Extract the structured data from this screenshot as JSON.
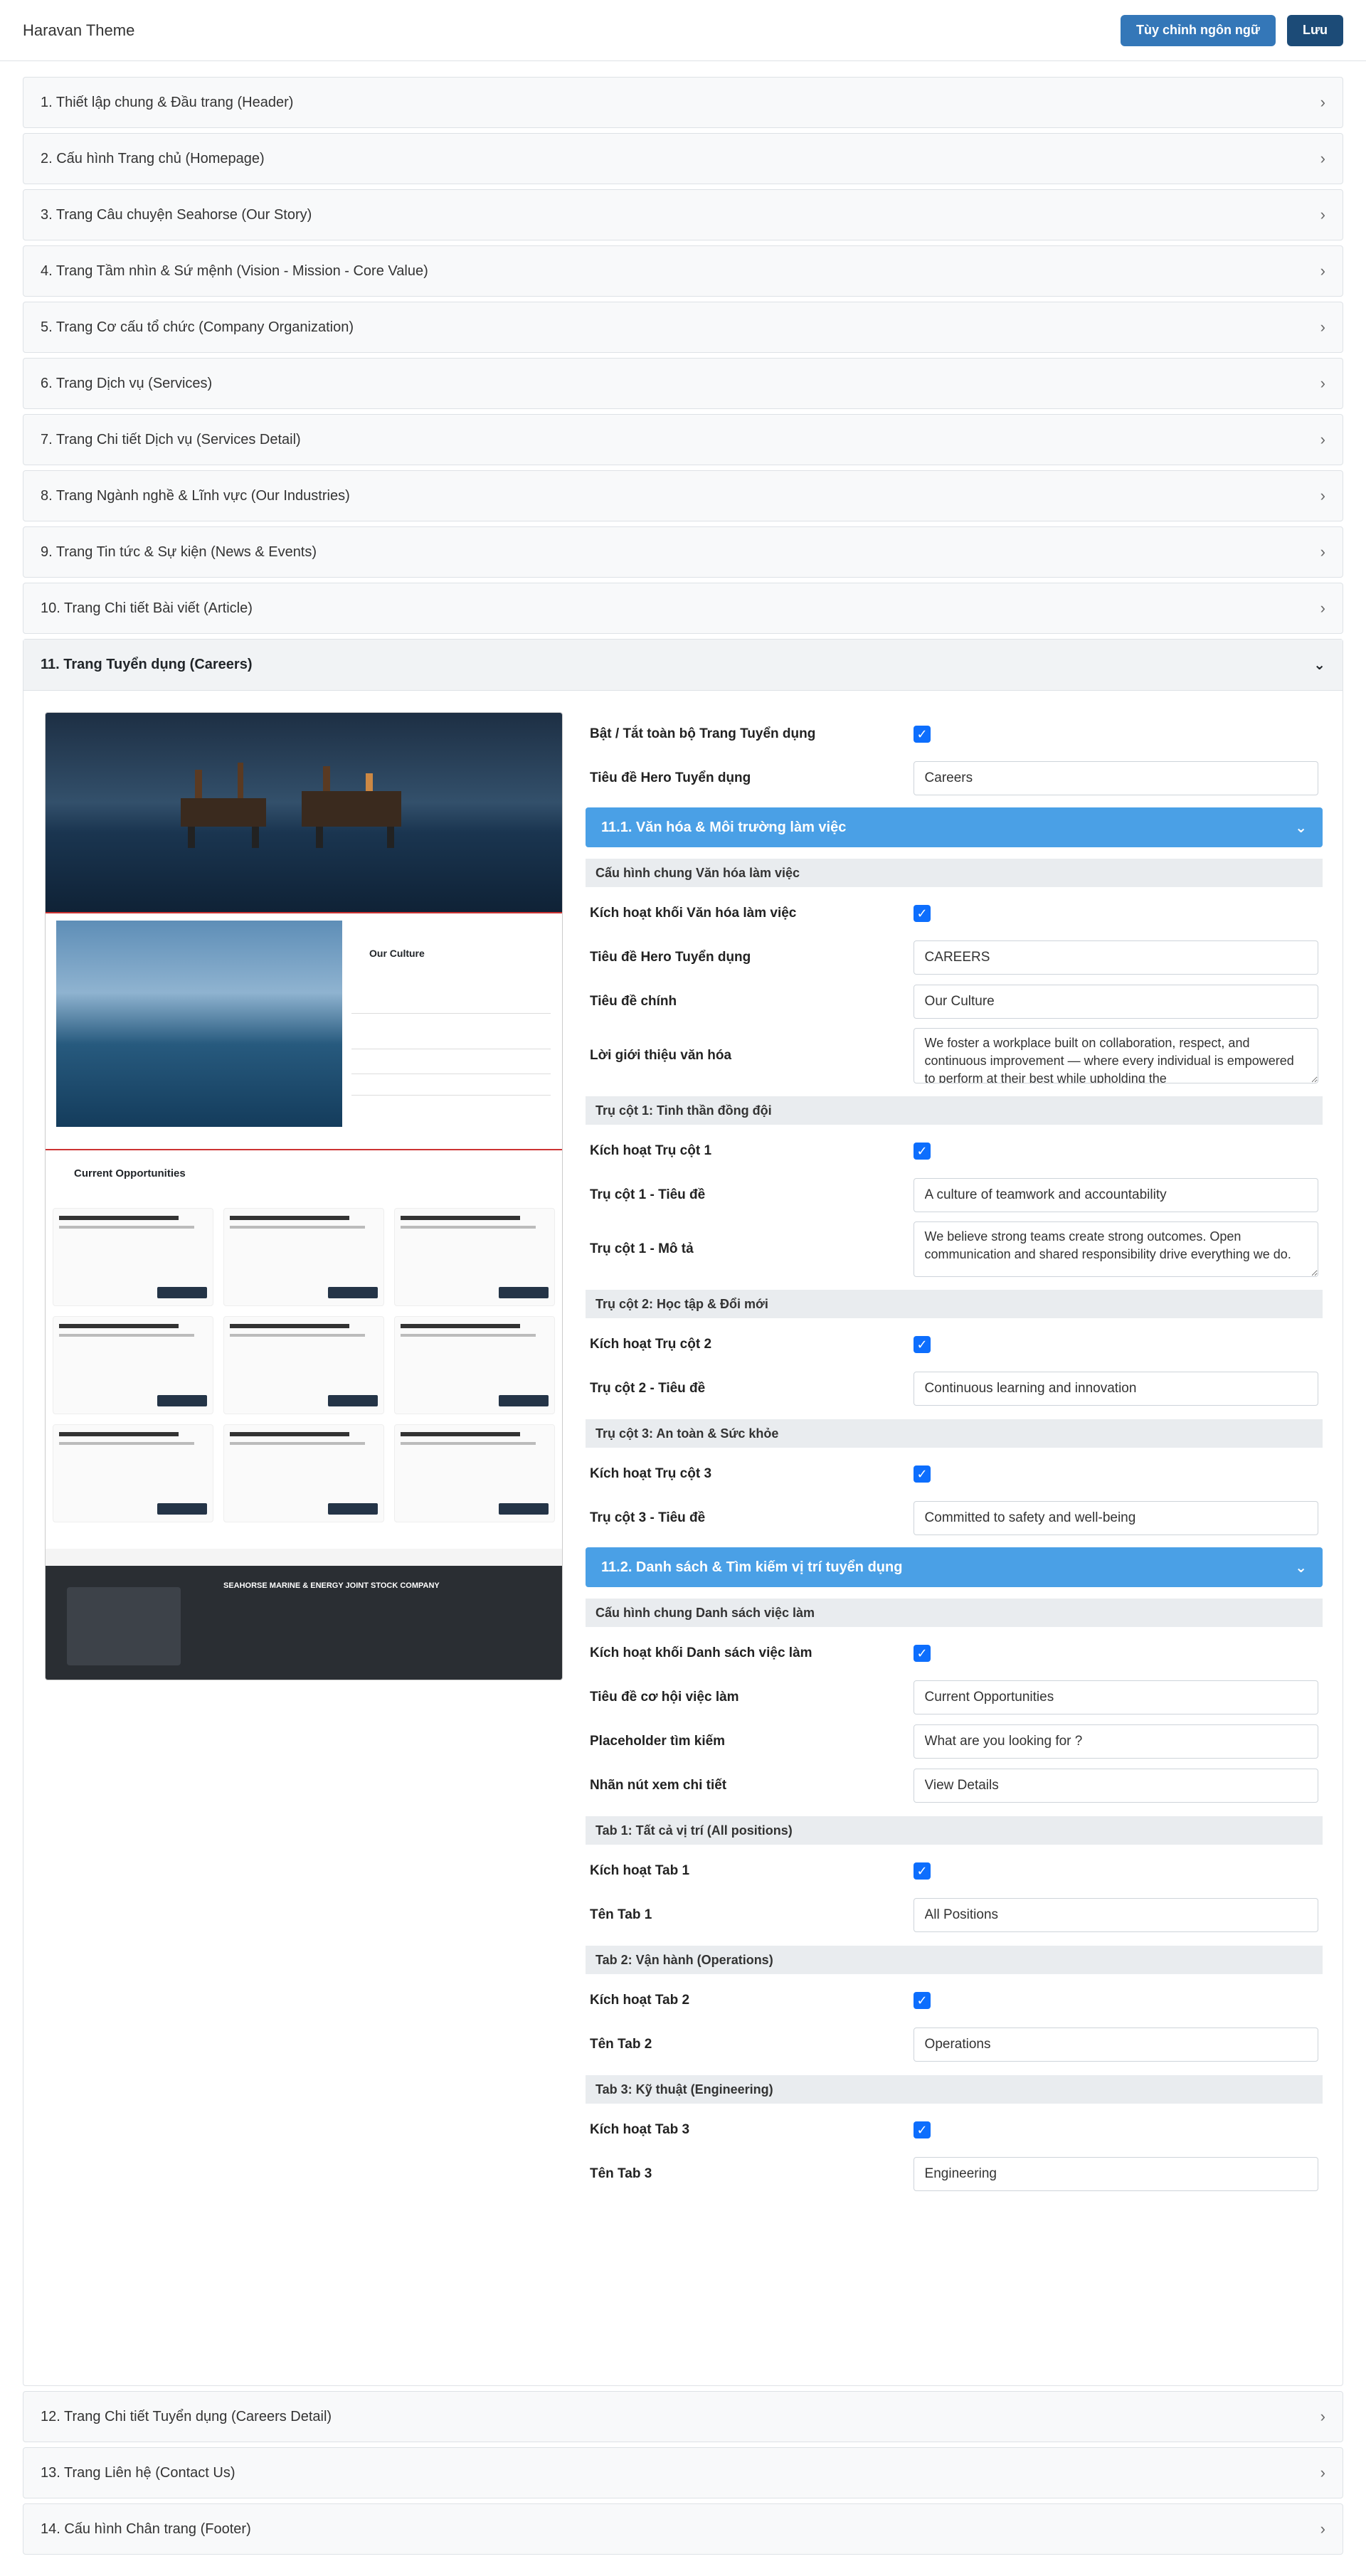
{
  "app_title": "Haravan Theme",
  "buttons": {
    "customize_lang": "Tùy chỉnh ngôn ngữ",
    "save": "Lưu"
  },
  "sections_before": [
    "1. Thiết lập chung & Đầu trang (Header)",
    "2. Cấu hình Trang chủ (Homepage)",
    "3. Trang Câu chuyện Seahorse (Our Story)",
    "4. Trang Tầm nhìn & Sứ mệnh (Vision - Mission - Core Value)",
    "5. Trang Cơ cấu tổ chức (Company Organization)",
    "6. Trang Dịch vụ (Services)",
    "7. Trang Chi tiết Dịch vụ (Services Detail)",
    "8. Trang Ngành nghề & Lĩnh vực (Our Industries)",
    "9. Trang Tin tức & Sự kiện (News & Events)",
    "10. Trang Chi tiết Bài viết (Article)"
  ],
  "open_section": "11. Trang Tuyển dụng (Careers)",
  "sections_after": [
    "12. Trang Chi tiết Tuyển dụng (Careers Detail)",
    "13. Trang Liên hệ (Contact Us)",
    "14. Cấu hình Chân trang (Footer)"
  ],
  "preview": {
    "culture_title": "Our Culture",
    "opps_title": "Current Opportunities",
    "footer_company": "SEAHORSE MARINE & ENERGY JOINT STOCK COMPANY"
  },
  "form": {
    "toggle_all": "Bật / Tắt toàn bộ Trang Tuyển dụng",
    "hero_title_label": "Tiêu đề Hero Tuyển dụng",
    "hero_title_value": "Careers",
    "sec1": "11.1. Văn hóa & Môi trường làm việc",
    "culture_general": "Cấu hình chung Văn hóa làm việc",
    "culture_enable": "Kích hoạt khối Văn hóa làm việc",
    "culture_hero_label": "Tiêu đề Hero Tuyển dụng",
    "culture_hero_value": "CAREERS",
    "main_title_label": "Tiêu đề chính",
    "main_title_value": "Our Culture",
    "intro_label": "Lời giới thiệu văn hóa",
    "intro_value": "We foster a workplace built on collaboration, respect, and continuous improvement — where every individual is empowered to perform at their best while upholding the",
    "p1_head": "Trụ cột 1: Tinh thần đồng đội",
    "p1_enable": "Kích hoạt Trụ cột 1",
    "p1_title_label": "Trụ cột 1 - Tiêu đề",
    "p1_title_value": "A culture of teamwork and accountability",
    "p1_desc_label": "Trụ cột 1 - Mô tả",
    "p1_desc_value": "We believe strong teams create strong outcomes. Open communication and shared responsibility drive everything we do.",
    "p2_head": "Trụ cột 2: Học tập & Đổi mới",
    "p2_enable": "Kích hoạt Trụ cột 2",
    "p2_title_label": "Trụ cột 2 - Tiêu đề",
    "p2_title_value": "Continuous learning and innovation",
    "p3_head": "Trụ cột 3: An toàn & Sức khỏe",
    "p3_enable": "Kích hoạt Trụ cột 3",
    "p3_title_label": "Trụ cột 3 - Tiêu đề",
    "p3_title_value": "Committed to safety and well-being",
    "sec2": "11.2. Danh sách & Tìm kiếm vị trí tuyển dụng",
    "jobs_general": "Cấu hình chung Danh sách việc làm",
    "jobs_enable": "Kích hoạt khối Danh sách việc làm",
    "jobs_title_label": "Tiêu đề cơ hội việc làm",
    "jobs_title_value": "Current Opportunities",
    "search_ph_label": "Placeholder tìm kiếm",
    "search_ph_value": "What are you looking for ?",
    "detail_btn_label": "Nhãn nút xem chi tiết",
    "detail_btn_value": "View Details",
    "tab1_head": "Tab 1: Tất cả vị trí (All positions)",
    "tab1_enable": "Kích hoạt Tab 1",
    "tab1_name_label": "Tên Tab 1",
    "tab1_name_value": "All Positions",
    "tab2_head": "Tab 2: Vận hành (Operations)",
    "tab2_enable": "Kích hoạt Tab 2",
    "tab2_name_label": "Tên Tab 2",
    "tab2_name_value": "Operations",
    "tab3_head": "Tab 3: Kỹ thuật (Engineering)",
    "tab3_enable": "Kích hoạt Tab 3",
    "tab3_name_label": "Tên Tab 3",
    "tab3_name_value": "Engineering"
  }
}
